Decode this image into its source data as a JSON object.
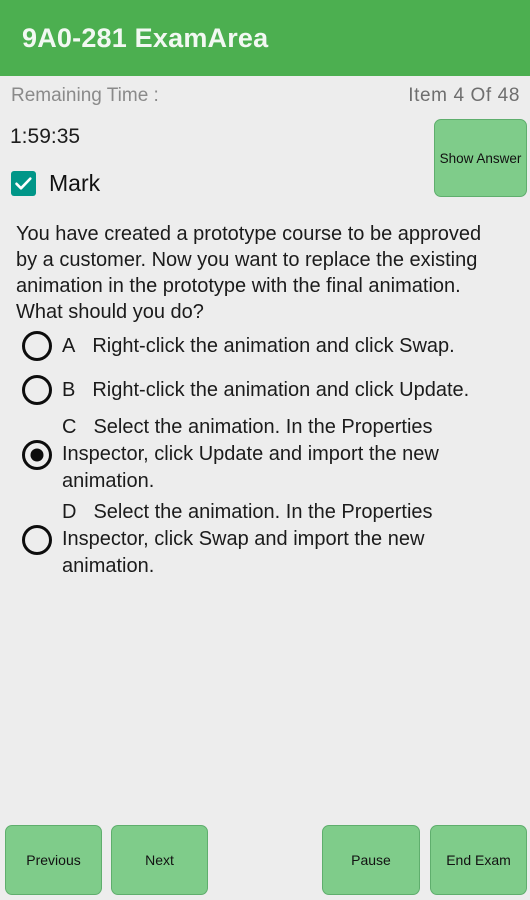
{
  "header": {
    "title": "9A0-281 ExamArea",
    "bg_color": "#4caf50",
    "text_color": "#f2f8f2"
  },
  "status": {
    "remaining_time_label": "Remaining Time :",
    "item_counter": "Item  4  Of  48",
    "timer_value": "1:59:35",
    "show_answer_label": "Show Answer",
    "mark_label": "Mark",
    "mark_checked": true,
    "checkbox_color": "#009688",
    "button_color": "#7fcc8a"
  },
  "question": {
    "text": "You have created a prototype course to be approved by a customer. Now you want to replace the existing animation in the prototype with the final animation. What should you do?",
    "selected_option": "C",
    "options": [
      {
        "letter": "A",
        "text": "Right-click the animation and click Swap.",
        "selected": false
      },
      {
        "letter": "B",
        "text": "Right-click the animation and click Update.",
        "selected": false
      },
      {
        "letter": "C",
        "text": "Select the animation. In the Properties Inspector, click Update and import the new animation.",
        "selected": true
      },
      {
        "letter": "D",
        "text": "Select the animation. In the Properties Inspector, click Swap and import the new animation.",
        "selected": false
      }
    ]
  },
  "bottom_bar": {
    "previous_label": "Previous",
    "next_label": "Next",
    "pause_label": "Pause",
    "end_exam_label": "End Exam"
  }
}
